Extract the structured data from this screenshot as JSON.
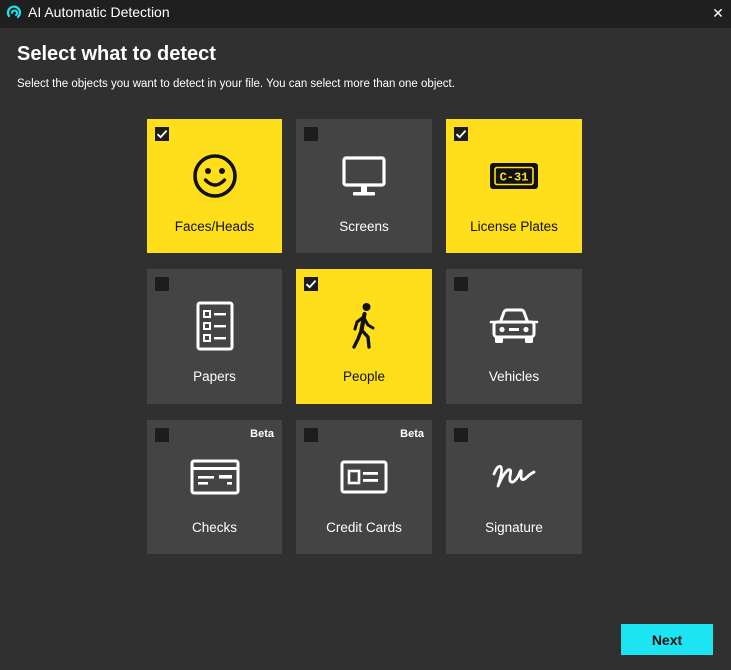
{
  "window": {
    "title": "AI Automatic Detection",
    "close_glyph": "✕",
    "app_icon": "swirl-logo-icon"
  },
  "page": {
    "heading": "Select what to detect",
    "subheading": "Select the objects you want to detect in your file. You can select more than one object."
  },
  "colors": {
    "background": "#303030",
    "titlebar": "#1f1f1f",
    "tile": "#444444",
    "tile_selected": "#ffdf1b",
    "accent": "#1de4f2"
  },
  "tiles": [
    {
      "label": "Faces/Heads",
      "selected": true,
      "beta": "",
      "icon": "smiley-face-icon"
    },
    {
      "label": "Screens",
      "selected": false,
      "beta": "",
      "icon": "monitor-icon"
    },
    {
      "label": "License Plates",
      "selected": true,
      "beta": "",
      "icon": "license-plate-icon",
      "plate_text": "C-31"
    },
    {
      "label": "Papers",
      "selected": false,
      "beta": "",
      "icon": "document-list-icon"
    },
    {
      "label": "People",
      "selected": true,
      "beta": "",
      "icon": "walking-person-icon"
    },
    {
      "label": "Vehicles",
      "selected": false,
      "beta": "",
      "icon": "car-icon"
    },
    {
      "label": "Checks",
      "selected": false,
      "beta": "Beta",
      "icon": "check-card-icon"
    },
    {
      "label": "Credit Cards",
      "selected": false,
      "beta": "Beta",
      "icon": "credit-card-icon"
    },
    {
      "label": "Signature",
      "selected": false,
      "beta": "",
      "icon": "signature-icon"
    }
  ],
  "footer": {
    "next_label": "Next"
  }
}
